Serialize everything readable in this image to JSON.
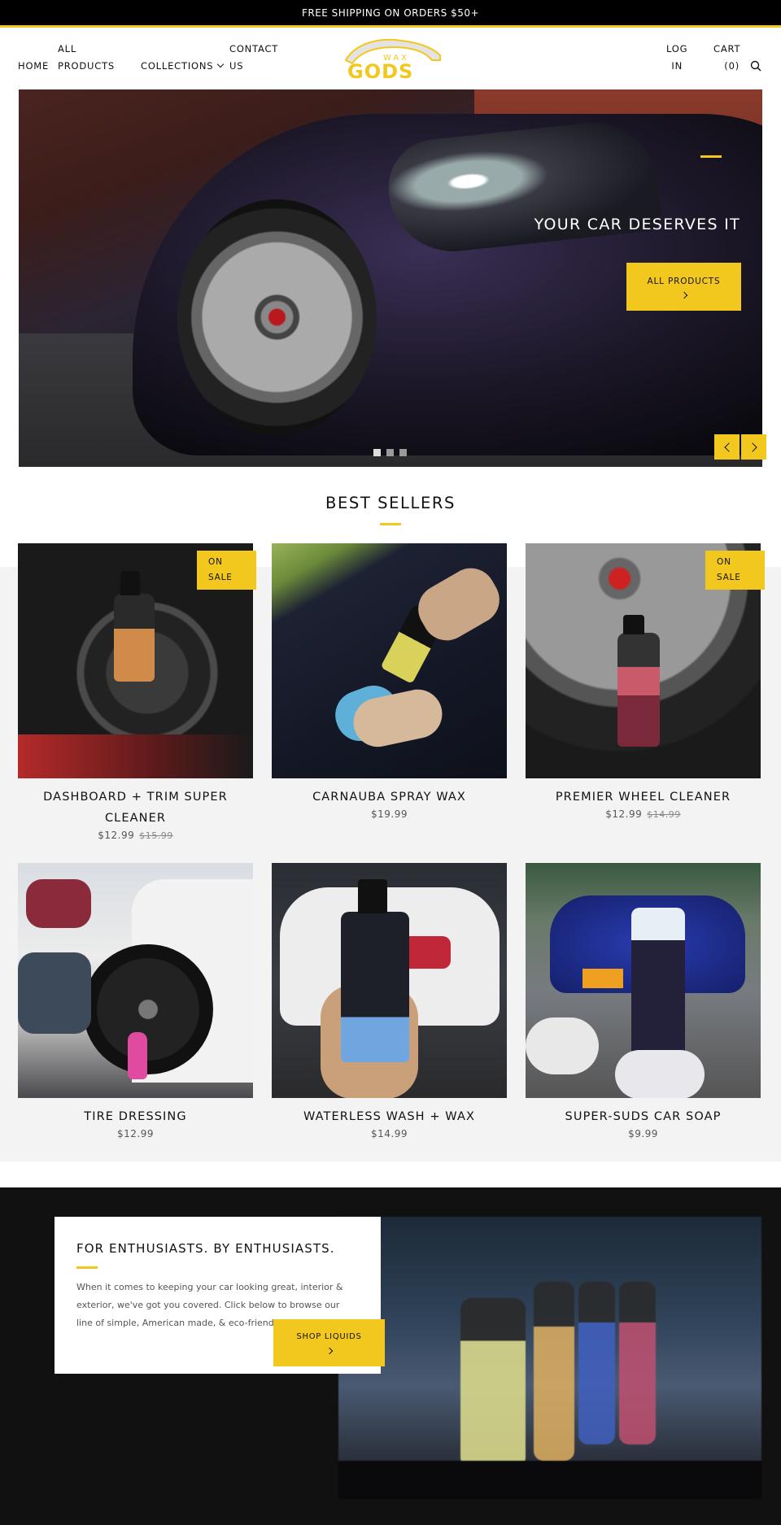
{
  "announcement": {
    "text": "FREE SHIPPING ON ORDERS $50+"
  },
  "header": {
    "nav": {
      "home": "HOME",
      "all_products_line1": "ALL",
      "all_products_line2": "PRODUCTS",
      "collections": "COLLECTIONS",
      "contact_line1": "CONTACT",
      "contact_line2": "US"
    },
    "logo": {
      "text_top": "WAX",
      "text_main": "GODS"
    },
    "account": {
      "login_line1": "LOG",
      "login_line2": "IN"
    },
    "cart": {
      "label": "CART",
      "count": "(0)"
    },
    "icons": {
      "search": "search-icon",
      "collections_dropdown": "chevron-down-icon"
    }
  },
  "hero": {
    "title": "YOUR CAR DESERVES IT",
    "cta_label": "ALL PRODUCTS",
    "slides": 3,
    "active_slide": 1
  },
  "best_sellers": {
    "title": "BEST SELLERS",
    "products": [
      {
        "name": "DASHBOARD + TRIM SUPER CLEANER",
        "price": "$12.99",
        "compare_price": "$15.99",
        "badge_line1": "ON",
        "badge_line2": "SALE"
      },
      {
        "name": "CARNAUBA SPRAY WAX",
        "price": "$19.99"
      },
      {
        "name": "PREMIER WHEEL CLEANER",
        "price": "$12.99",
        "compare_price": "$14.99",
        "badge_line1": "ON",
        "badge_line2": "SALE"
      },
      {
        "name": "TIRE DRESSING",
        "price": "$12.99"
      },
      {
        "name": "WATERLESS WASH + WAX",
        "price": "$14.99"
      },
      {
        "name": "SUPER-SUDS CAR SOAP",
        "price": "$9.99"
      }
    ]
  },
  "promo": {
    "title": "FOR ENTHUSIASTS. BY ENTHUSIASTS.",
    "text": "When it comes to keeping your car looking great, interior & exterior, we've got you covered. Click below to browse our line of simple, American made, & eco-friendly liquids.",
    "cta_label": "SHOP LIQUIDS"
  },
  "colors": {
    "accent": "#f2c81e",
    "announcement_bg": "#000000",
    "dark_section": "#111111",
    "band": "#f3f3f3"
  }
}
